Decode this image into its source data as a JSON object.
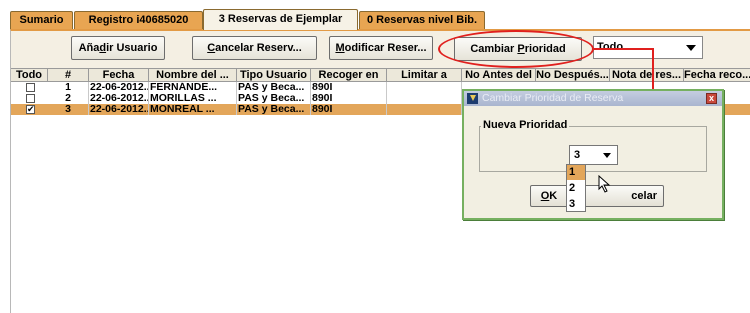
{
  "tabs": [
    {
      "label": "Sumario",
      "active": false
    },
    {
      "label": "Registro i40685020",
      "active": false
    },
    {
      "label": "3 Reservas de Ejemplar",
      "active": true
    },
    {
      "label": "0 Reservas nivel Bib.",
      "active": false
    }
  ],
  "toolbar": {
    "add_user": {
      "pre": "Aña",
      "ul": "d",
      "post": "ir Usuario"
    },
    "cancel": {
      "pre": "",
      "ul": "C",
      "post": "ancelar Reserv..."
    },
    "modify": {
      "pre": "",
      "ul": "M",
      "post": "odificar Reser..."
    },
    "change_priority": {
      "pre": "Cambiar ",
      "ul": "P",
      "post": "rioridad"
    },
    "combo_value": "Todo"
  },
  "table": {
    "columns": [
      "Todo",
      "#",
      "Fecha",
      "Nombre del ...",
      "Tipo Usuario",
      "Recoger en",
      "Limitar a",
      "No Antes del",
      "No Después...",
      "Nota de res...",
      "Fecha reco..."
    ],
    "rows": [
      {
        "checked": false,
        "num": "1",
        "fecha": "22-06-2012...",
        "nombre": "FERNÁNDE...",
        "tipo": "PAS y Beca...",
        "recoger": "890I",
        "selected": false
      },
      {
        "checked": false,
        "num": "2",
        "fecha": "22-06-2012...",
        "nombre": "MORILLAS ...",
        "tipo": "PAS y Beca...",
        "recoger": "890I",
        "selected": false
      },
      {
        "checked": true,
        "num": "3",
        "fecha": "22-06-2012...",
        "nombre": "MONREAL ...",
        "tipo": "PAS y Beca...",
        "recoger": "890I",
        "selected": true
      }
    ]
  },
  "dialog": {
    "title": "Cambiar Prioridad de Reserva",
    "close_glyph": "x",
    "group_label": "Nueva Prioridad",
    "priority_value": "3",
    "options": [
      "1",
      "2",
      "3"
    ],
    "highlighted_option": "1",
    "ok": {
      "pre": "",
      "ul": "O",
      "post": "K"
    },
    "cancel_visible": "celar"
  },
  "colors": {
    "tab_orange": "#e8a552",
    "selection": "#e3a65a",
    "annotation_red": "#e0201e",
    "dialog_border": "#76b060"
  }
}
